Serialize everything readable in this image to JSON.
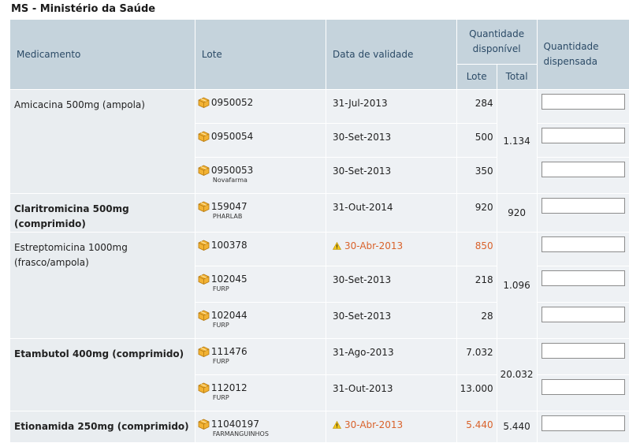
{
  "page_title": "MS - Ministério da Saúde",
  "headers": {
    "medicamento": "Medicamento",
    "lote": "Lote",
    "validade": "Data de validade",
    "qtd_disponivel": "Quantidade disponível",
    "qtd_lote": "Lote",
    "qtd_total": "Total",
    "qtd_dispensada": "Quantidade dispensada"
  },
  "groups": [
    {
      "medicamento": "Amicacina 500mg (ampola)",
      "total": "1.134",
      "lots": [
        {
          "lote": "0950052",
          "fornecedor": "",
          "validade": "31-Jul-2013",
          "qtd": "284",
          "warning": false
        },
        {
          "lote": "0950054",
          "fornecedor": "",
          "validade": "30-Set-2013",
          "qtd": "500",
          "warning": false
        },
        {
          "lote": "0950053",
          "fornecedor": "Novafarma",
          "validade": "30-Set-2013",
          "qtd": "350",
          "warning": false
        }
      ]
    },
    {
      "medicamento": "Claritromicina 500mg (comprimido)",
      "total": "920",
      "lots": [
        {
          "lote": "159047",
          "fornecedor": "PHARLAB",
          "validade": "31-Out-2014",
          "qtd": "920",
          "warning": false
        }
      ]
    },
    {
      "medicamento": "Estreptomicina 1000mg (frasco/ampola)",
      "total": "1.096",
      "lots": [
        {
          "lote": "100378",
          "fornecedor": "",
          "validade": "30-Abr-2013",
          "qtd": "850",
          "warning": true
        },
        {
          "lote": "102045",
          "fornecedor": "FURP",
          "validade": "30-Set-2013",
          "qtd": "218",
          "warning": false
        },
        {
          "lote": "102044",
          "fornecedor": "FURP",
          "validade": "30-Set-2013",
          "qtd": "28",
          "warning": false
        }
      ]
    },
    {
      "medicamento": "Etambutol 400mg (comprimido)",
      "total": "20.032",
      "lots": [
        {
          "lote": "111476",
          "fornecedor": "FURP",
          "validade": "31-Ago-2013",
          "qtd": "7.032",
          "warning": false
        },
        {
          "lote": "112012",
          "fornecedor": "FURP",
          "validade": "31-Out-2013",
          "qtd": "13.000",
          "warning": false
        }
      ]
    },
    {
      "medicamento": "Etionamida 250mg (comprimido)",
      "total": "5.440",
      "lots": [
        {
          "lote": "11040197",
          "fornecedor": "FARMANGUINHOS",
          "validade": "30-Abr-2013",
          "qtd": "5.440",
          "warning": true
        }
      ]
    }
  ],
  "colors": {
    "header_bg": "#c5d3dc",
    "header_text": "#2b4a66",
    "warning": "#d9622b",
    "row_bg": "#eef1f4"
  },
  "icons": {
    "lot": "package-icon",
    "warning": "warning-icon"
  }
}
